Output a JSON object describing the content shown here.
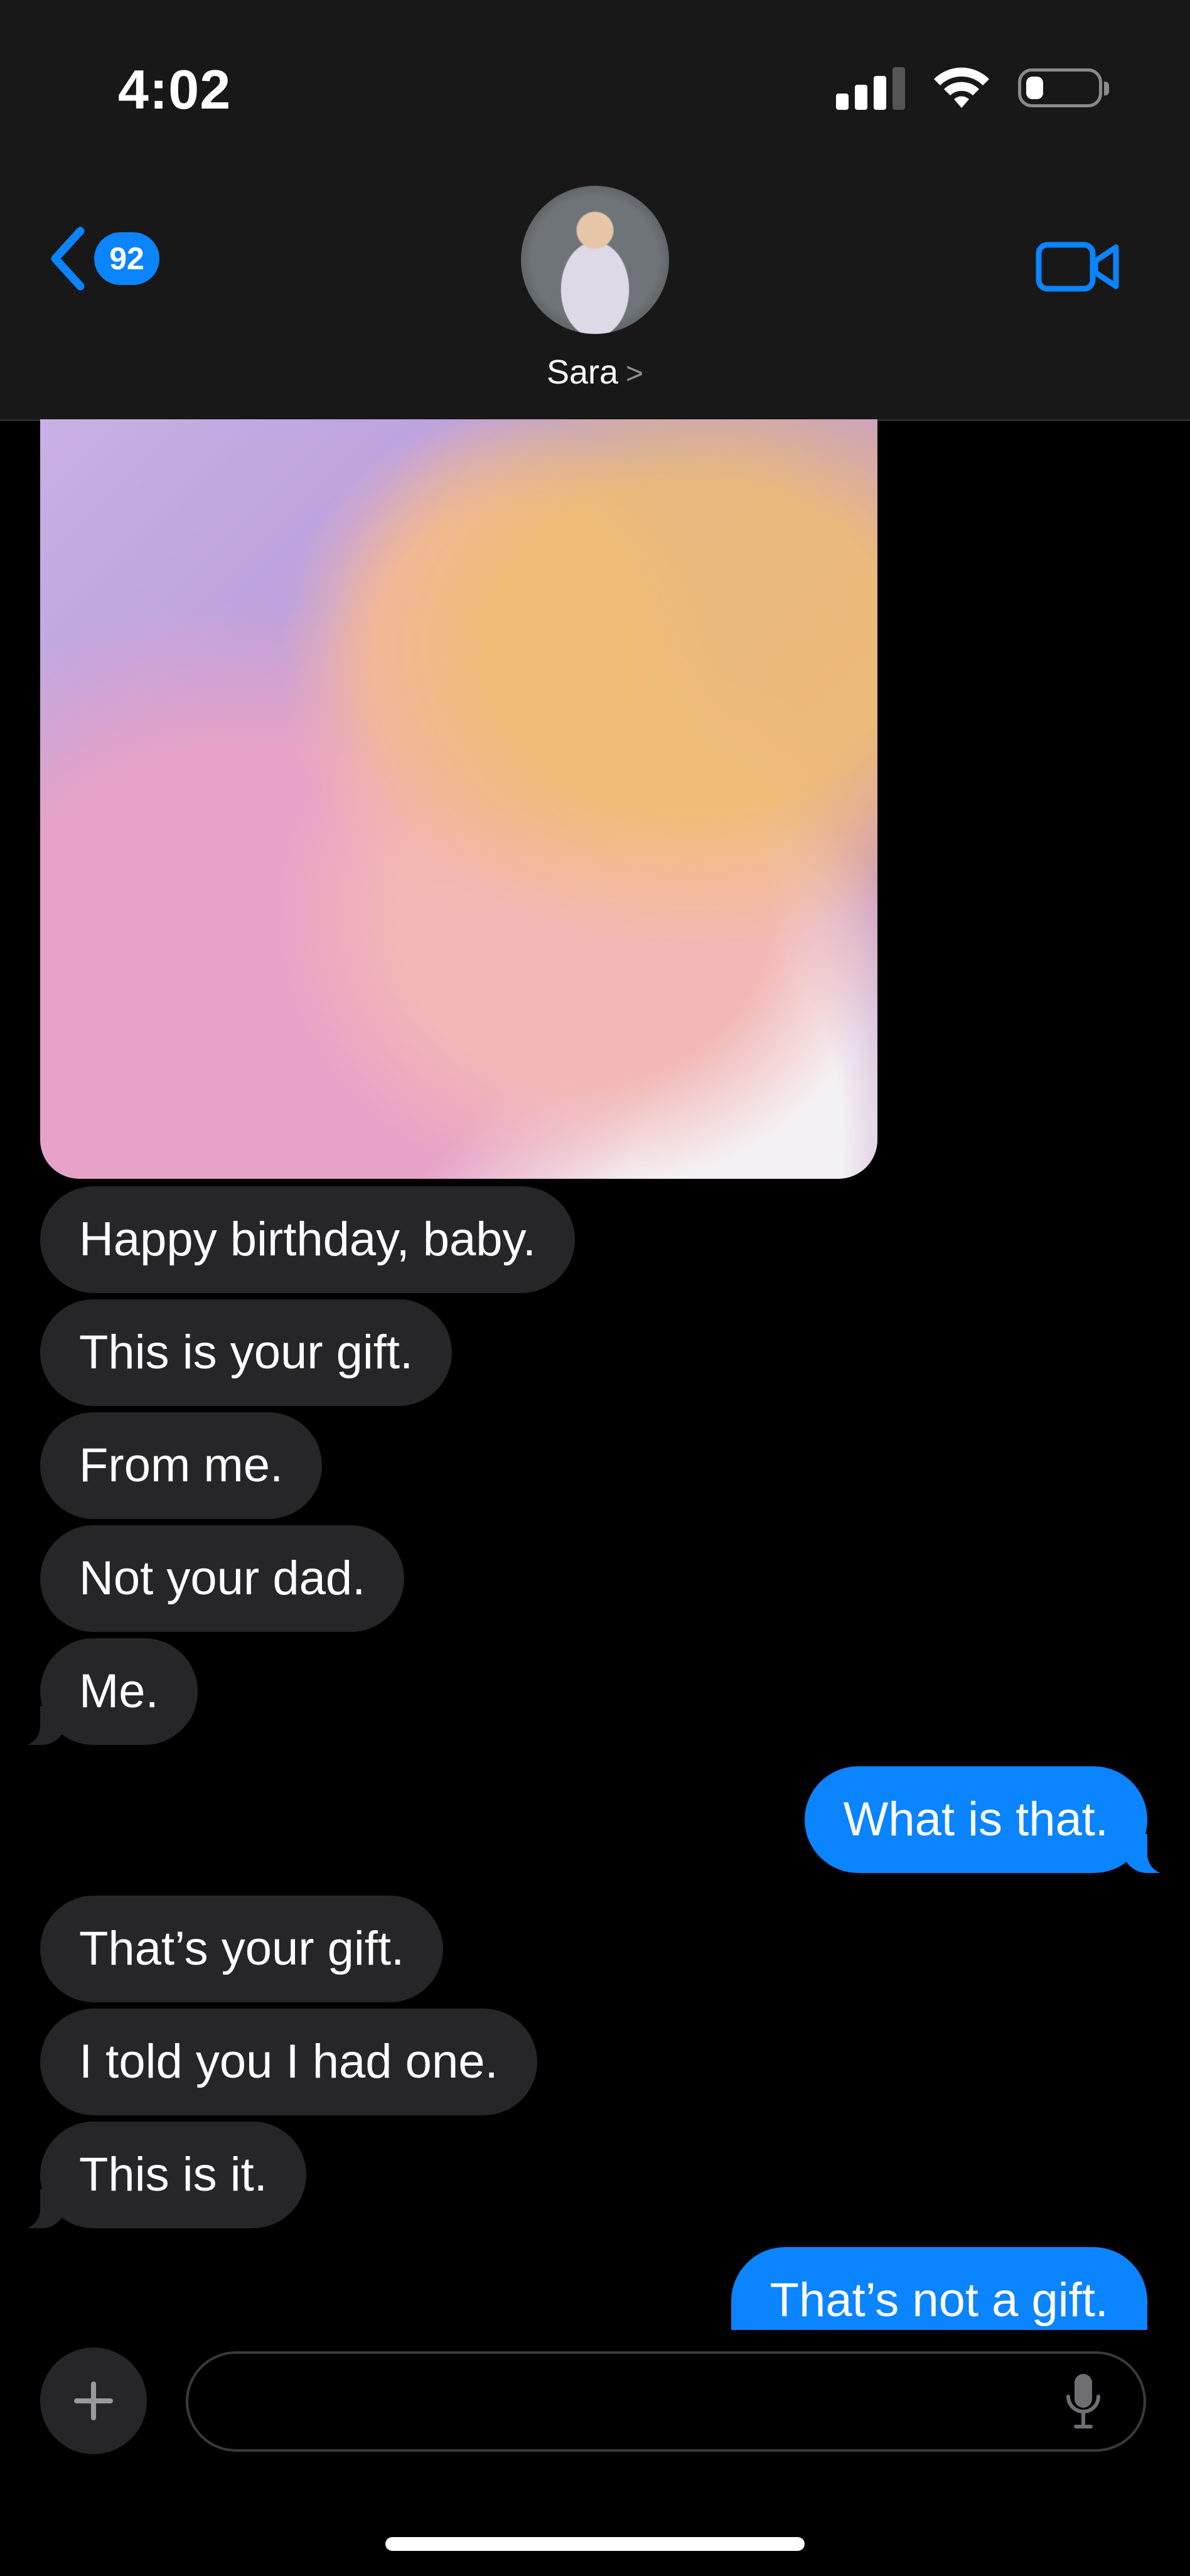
{
  "status_bar": {
    "time": "4:02",
    "signal_bars_active": 3,
    "battery_level_percent": 20
  },
  "header": {
    "back_count": "92",
    "contact_name": "Sara",
    "contact_chevron": ">",
    "icons": [
      "chevron-left-icon",
      "video-camera-icon"
    ]
  },
  "messages": [
    {
      "from": "them",
      "type": "photo"
    },
    {
      "from": "them",
      "text": "Happy birthday, baby."
    },
    {
      "from": "them",
      "text": "This is your gift."
    },
    {
      "from": "them",
      "text": "From me."
    },
    {
      "from": "them",
      "text": "Not your dad."
    },
    {
      "from": "them",
      "text": "Me."
    },
    {
      "from": "me",
      "text": "What is that."
    },
    {
      "from": "them",
      "text": "That’s your gift."
    },
    {
      "from": "them",
      "text": "I told you I had one."
    },
    {
      "from": "them",
      "text": "This is it."
    },
    {
      "from": "me",
      "text": "That’s not a gift."
    }
  ],
  "composer": {
    "placeholder": "",
    "icons": [
      "plus-icon",
      "microphone-icon"
    ]
  },
  "colors": {
    "accent": "#0a84ff",
    "incoming_bubble": "#262628",
    "background": "#000000",
    "header": "#181818"
  }
}
